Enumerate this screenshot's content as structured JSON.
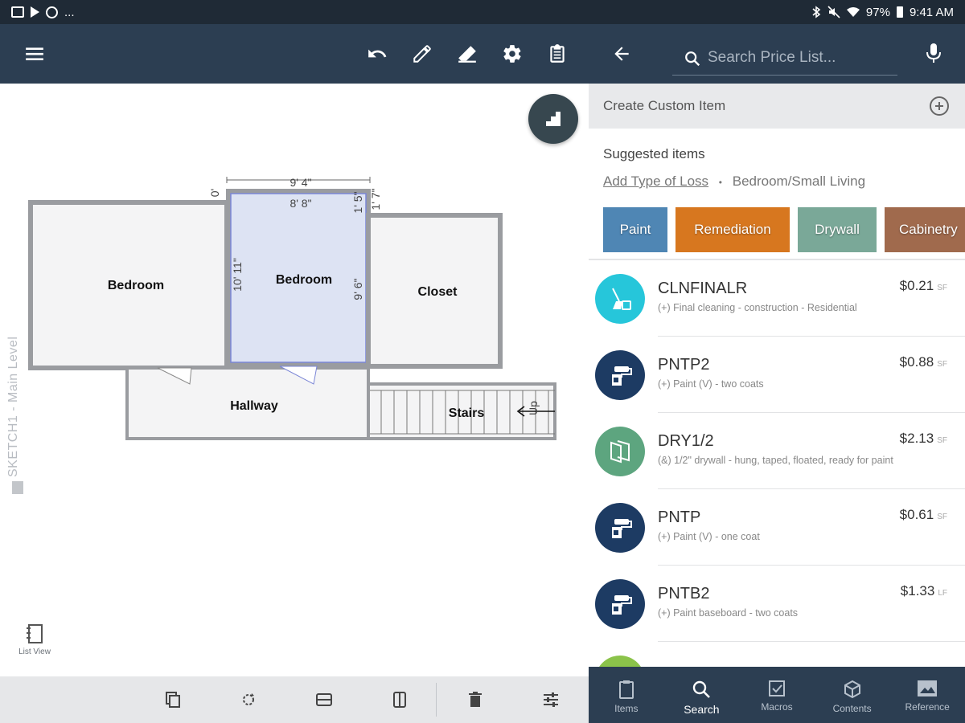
{
  "status_bar": {
    "left_extra": "...",
    "battery": "97%",
    "time": "9:41 AM"
  },
  "toolbar": {
    "icons": [
      "menu-icon",
      "undo-icon",
      "pencil-icon",
      "eraser-icon",
      "settings-icon",
      "clipboard-icon"
    ]
  },
  "sketch": {
    "side_label": "SKETCH1 - Main Level",
    "list_view_label": "List View",
    "rooms": {
      "bedroom_left": "Bedroom",
      "bedroom_center": "Bedroom",
      "closet": "Closet",
      "hallway": "Hallway",
      "stairs": "Stairs",
      "up": "Up"
    },
    "dimensions": {
      "top_outer": "9' 4\"",
      "top_inner": "8' 8\"",
      "left_height": "10' 11\"",
      "right_height": "9' 6\"",
      "small_left": "0'",
      "small_right_a": "1' 5\"",
      "small_right_b": "1' 7\""
    }
  },
  "bottom_bar": {
    "icons": [
      "copy-icon",
      "rotate-icon",
      "flip-horizontal-icon",
      "flip-vertical-icon",
      "delete-icon",
      "tune-icon"
    ]
  },
  "price_list": {
    "search_placeholder": "Search Price List...",
    "create_custom": "Create Custom Item",
    "suggested_title": "Suggested items",
    "add_type_of_loss": "Add Type of Loss",
    "bullet": "•",
    "room_type": "Bedroom/Small Living",
    "chips": [
      {
        "label": "Paint",
        "color": "#4f86b4"
      },
      {
        "label": "Remediation",
        "color": "#d7771f"
      },
      {
        "label": "Drywall",
        "color": "#7aa898"
      },
      {
        "label": "Cabinetry",
        "color": "#a06a4d"
      }
    ],
    "items": [
      {
        "code": "CLNFINALR",
        "price": "$0.21",
        "unit": "SF",
        "desc": "(+) Final cleaning - construction - Residential",
        "color": "#26c6da",
        "icon": "broom-bucket-icon"
      },
      {
        "code": "PNTP2",
        "price": "$0.88",
        "unit": "SF",
        "desc": "(+) Paint (V) - two coats",
        "color": "#1d3b63",
        "icon": "paint-roller-icon"
      },
      {
        "code": "DRY1/2",
        "price": "$2.13",
        "unit": "SF",
        "desc": "(&) 1/2\" drywall - hung, taped, floated, ready for paint",
        "color": "#5da57f",
        "icon": "drywall-icon"
      },
      {
        "code": "PNTP",
        "price": "$0.61",
        "unit": "SF",
        "desc": "(+) Paint (V) - one coat",
        "color": "#1d3b63",
        "icon": "paint-roller-icon"
      },
      {
        "code": "PNTB2",
        "price": "$1.33",
        "unit": "LF",
        "desc": "(+) Paint baseboard - two coats",
        "color": "#1d3b63",
        "icon": "paint-roller-icon"
      }
    ],
    "nav": [
      {
        "label": "Items",
        "icon": "clipboard-icon",
        "active": false
      },
      {
        "label": "Search",
        "icon": "search-icon",
        "active": true
      },
      {
        "label": "Macros",
        "icon": "checkbox-icon",
        "active": false
      },
      {
        "label": "Contents",
        "icon": "cube-icon",
        "active": false
      },
      {
        "label": "Reference",
        "icon": "image-icon",
        "active": false
      }
    ]
  }
}
